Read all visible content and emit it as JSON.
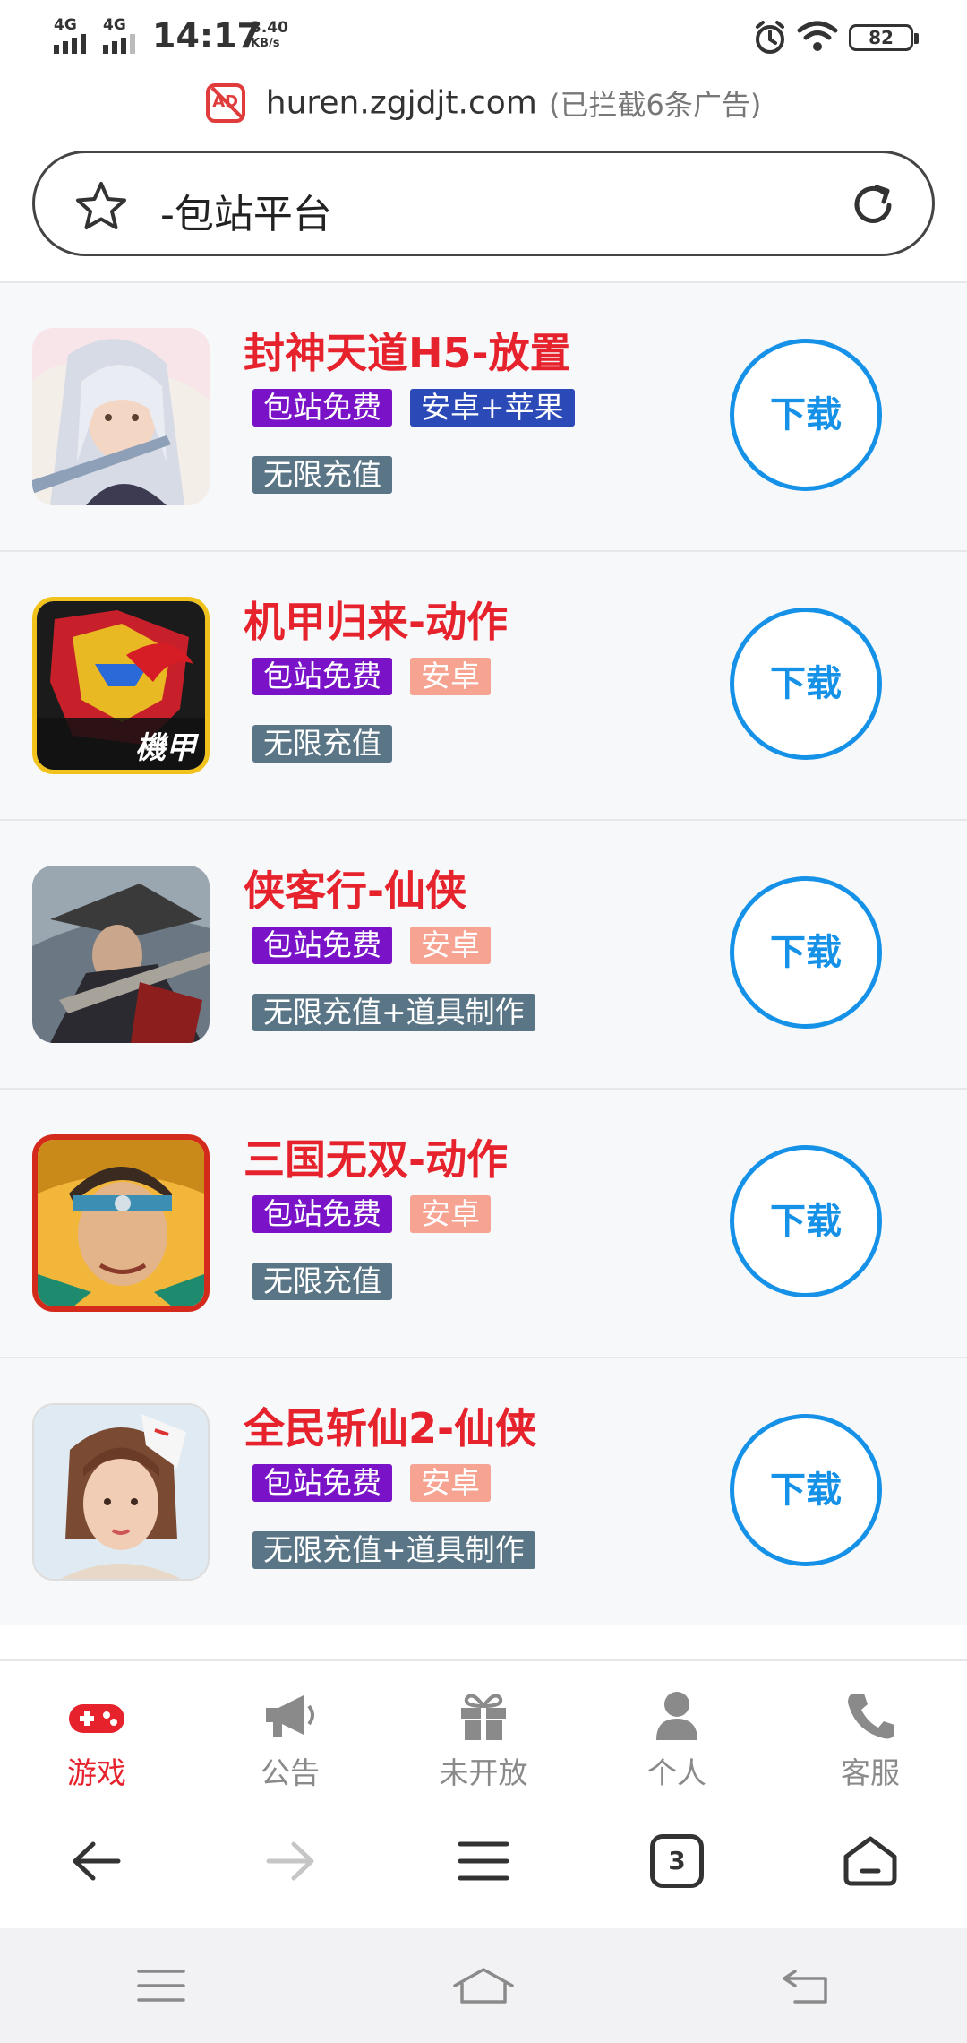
{
  "status_bar": {
    "signal1": "4G",
    "signal2": "4G",
    "time": "14:17",
    "speed_value": "3.40",
    "speed_unit": "KB/s",
    "battery": "82"
  },
  "browser": {
    "ad_badge": "AD",
    "host": "huren.zgjdjt.com",
    "blocked_ads": "(已拦截6条广告)",
    "search_text": "-包站平台"
  },
  "games": [
    {
      "title": "封神天道H5-放置",
      "tags": [
        "包站免费",
        "安卓+苹果"
      ],
      "extra": "无限充值",
      "download": "下载"
    },
    {
      "title": "机甲归来-动作",
      "tags": [
        "包站免费",
        "安卓"
      ],
      "extra": "无限充值",
      "download": "下载",
      "thumb_text": "機甲"
    },
    {
      "title": "侠客行-仙侠",
      "tags": [
        "包站免费",
        "安卓"
      ],
      "extra": "无限充值+道具制作",
      "download": "下载"
    },
    {
      "title": "三国无双-动作",
      "tags": [
        "包站免费",
        "安卓"
      ],
      "extra": "无限充值",
      "download": "下载"
    },
    {
      "title": "全民斩仙2-仙侠",
      "tags": [
        "包站免费",
        "安卓"
      ],
      "extra": "无限充值+道具制作",
      "download": "下载"
    }
  ],
  "tabbar": {
    "items": [
      {
        "label": "游戏",
        "icon": "gamepad-icon",
        "active": true
      },
      {
        "label": "公告",
        "icon": "megaphone-icon"
      },
      {
        "label": "未开放",
        "icon": "gift-icon"
      },
      {
        "label": "个人",
        "icon": "person-icon"
      },
      {
        "label": "客服",
        "icon": "phone-icon"
      }
    ]
  },
  "browser_nav": {
    "tab_count": "3"
  },
  "colors": {
    "title_red": "#e6222c",
    "download_blue": "#1591e8",
    "tag_purple": "#7a13c8",
    "tag_blue": "#2c49b8",
    "tag_salmon": "#f6a391",
    "tag_slate": "#5a7686"
  }
}
